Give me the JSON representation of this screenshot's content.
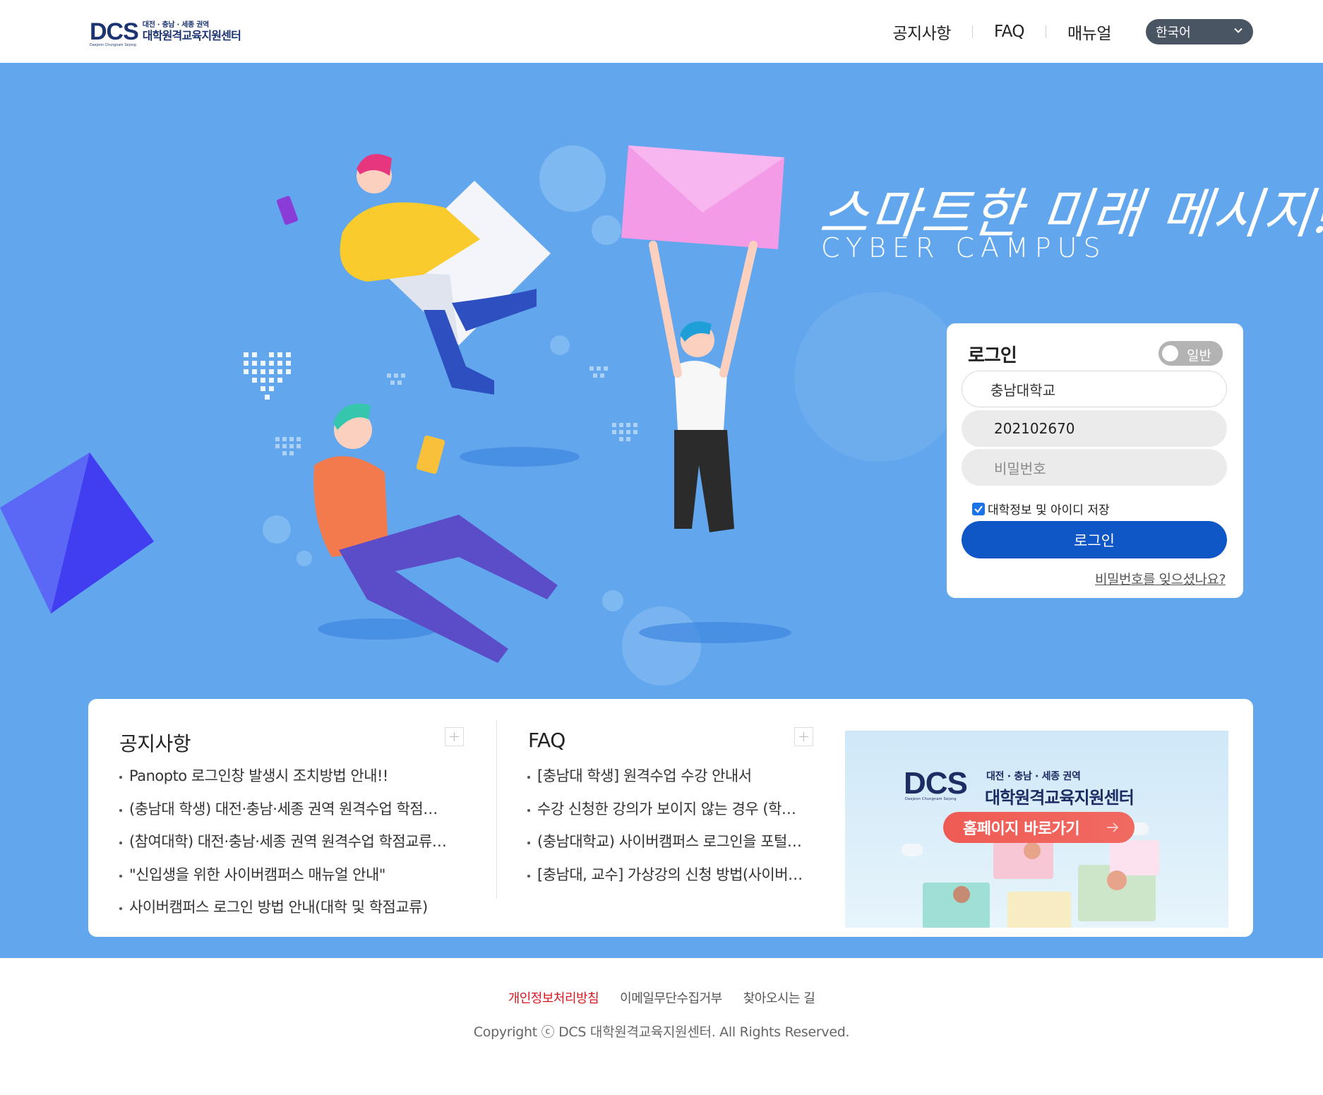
{
  "header": {
    "logo": {
      "dcs": "DCS",
      "sub": "Daejeon Chungnam Sejong",
      "line1": "대전 · 충남 · 세종 권역",
      "line2": "대학원격교육지원센터"
    },
    "nav": [
      {
        "label": "공지사항"
      },
      {
        "label": "FAQ"
      },
      {
        "label": "매뉴얼"
      }
    ],
    "language": "한국어"
  },
  "hero": {
    "slogan": "스마트한 미래 메시지!",
    "subtitle": "CYBER CAMPUS"
  },
  "login": {
    "title": "로그인",
    "mode_toggle": "일반",
    "university_value": "충남대학교",
    "id_value": "202102670",
    "password_placeholder": "비밀번호",
    "save_label": "대학정보 및 아이디 저장",
    "save_checked": true,
    "submit_label": "로그인",
    "forgot_label": "비밀번호를 잊으셨나요?"
  },
  "notice": {
    "title": "공지사항",
    "items": [
      "Panopto 로그인창 발생시 조치방법 안내!!",
      "(충남대 학생) 대전·충남·세종 권역 원격수업 학점교…",
      "(참여대학) 대전·충남·세종 권역 원격수업 학점교류 …",
      "\"신입생을 위한 사이버캠퍼스 매뉴얼 안내\"",
      "사이버캠퍼스 로그인 방법 안내(대학 및 학점교류)"
    ]
  },
  "faq": {
    "title": "FAQ",
    "items": [
      "[충남대 학생] 원격수업 수강 안내서",
      "수강 신청한 강의가 보이지 않는 경우 (학…",
      "(충남대학교) 사이버캠퍼스 로그인을 포털…",
      "[충남대, 교수] 가상강의 신청 방법(사이버…"
    ]
  },
  "banner": {
    "dcs": "DCS",
    "sub": "Daejeon Chungnam Sejong",
    "line1": "대전 · 충남 · 세종 권역",
    "line2": "대학원격교육지원센터",
    "button_label": "홈페이지 바로가기"
  },
  "footer": {
    "links": [
      {
        "label": "개인정보처리방침"
      },
      {
        "label": "이메일무단수집거부"
      },
      {
        "label": "찾아오시는 길"
      }
    ],
    "copyright": "Copyright ⓒ DCS 대학원격교육지원센터. All Rights Reserved."
  },
  "colors": {
    "hero_bg": "#62a7ed",
    "login_button": "#0f57c6",
    "privacy_link": "#d7191f",
    "banner_button": "#ef5b54",
    "lang_select_bg": "#4a5564"
  }
}
